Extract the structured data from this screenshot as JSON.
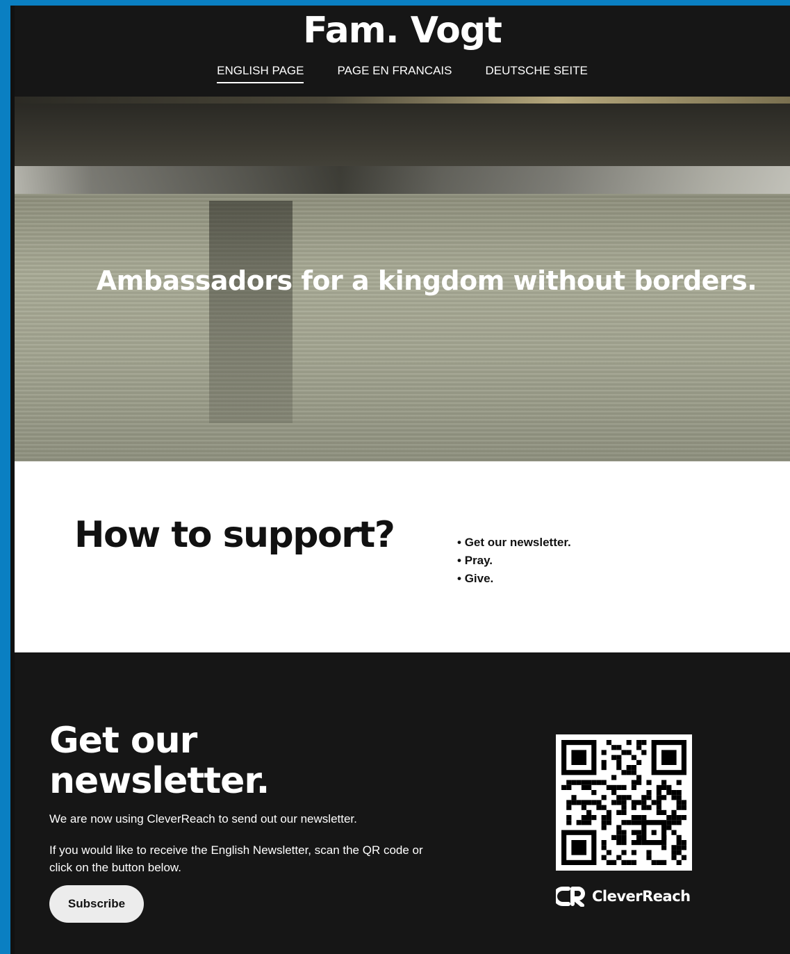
{
  "header": {
    "site_title": "Fam. Vogt",
    "nav": [
      {
        "label": "ENGLISH PAGE",
        "active": true
      },
      {
        "label": "PAGE EN FRANCAIS",
        "active": false
      },
      {
        "label": "DEUTSCHE SEITE",
        "active": false
      }
    ]
  },
  "hero": {
    "tagline": "Ambassadors for a kingdom without borders."
  },
  "support": {
    "title": "How to support?",
    "items": [
      "Get our newsletter.",
      "Pray.",
      "Give."
    ]
  },
  "newsletter": {
    "title": "Get our newsletter.",
    "text1": "We are now using CleverReach to send out our newsletter.",
    "text2": "If you would like to receive the English Newsletter, scan the QR code or click on the button below.",
    "subscribe_label": "Subscribe",
    "brand_name": "CleverReach"
  },
  "colors": {
    "dark_background": "#161616",
    "page_edge": "#0a7fc2",
    "button": "#ececec"
  }
}
